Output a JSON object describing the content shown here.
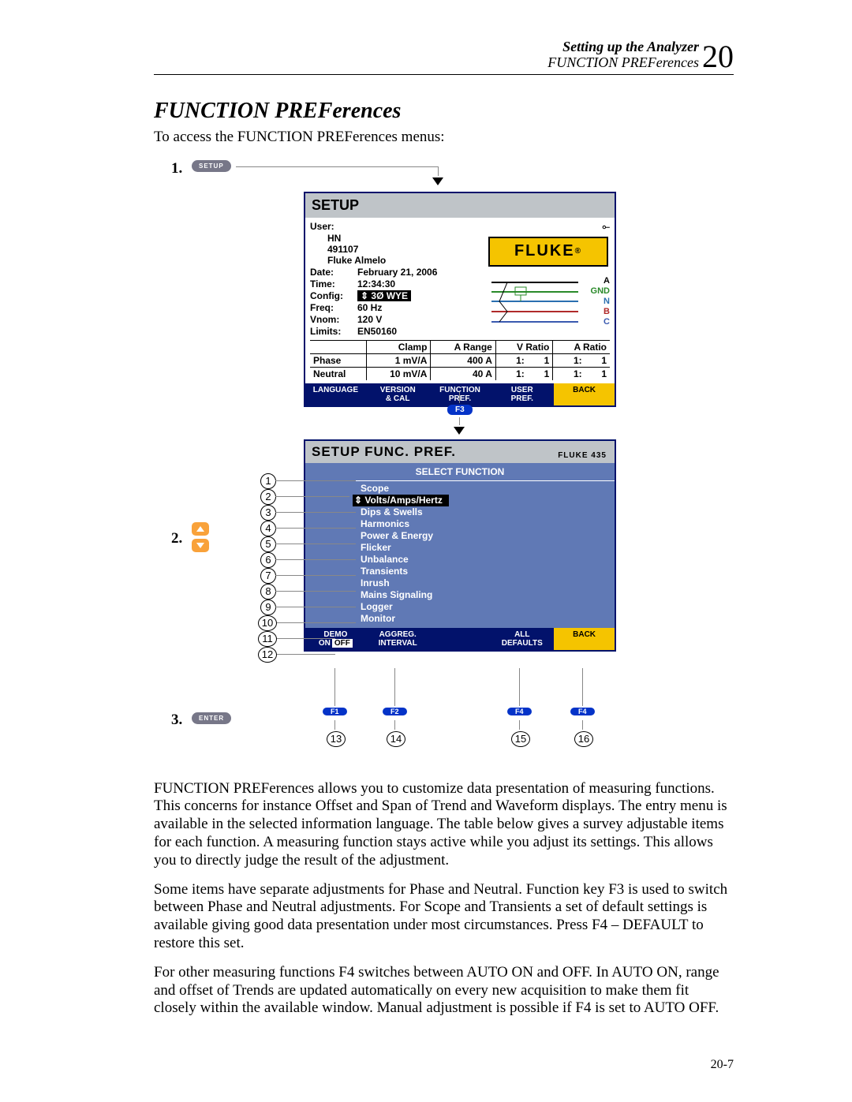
{
  "header": {
    "line1": "Setting up the Analyzer",
    "line2": "FUNCTION PREFerences",
    "chapter": "20"
  },
  "title": "FUNCTION PREFerences",
  "intro": "To access the FUNCTION PREFerences menus:",
  "steps": {
    "s1": "1.",
    "s2": "2.",
    "s3": "3."
  },
  "btn": {
    "setup": "SETUP",
    "enter": "ENTER"
  },
  "setup_screen": {
    "title": "SETUP",
    "user_label": "User:",
    "user_lines": [
      "HN",
      "491107",
      "Fluke Almelo"
    ],
    "date_k": "Date:",
    "date_v": "February 21, 2006",
    "time_k": "Time:",
    "time_v": "12:34:30",
    "config_k": "Config:",
    "config_v": "⇕ 3Ø WYE",
    "freq_k": "Freq:",
    "freq_v": "60 Hz",
    "vnom_k": "Vnom:",
    "vnom_v": "120 V",
    "limits_k": "Limits:",
    "limits_v": "EN50160",
    "logo": "FLUKE",
    "phase_labels": [
      "A",
      "GND",
      "N",
      "B",
      "C"
    ],
    "phase_colors": [
      "#000",
      "#2a8a2a",
      "#2a6fb0",
      "#b02a2a",
      "#3a5ab0"
    ],
    "table": {
      "head": [
        "",
        "Clamp",
        "A Range",
        "V Ratio",
        "A Ratio"
      ],
      "rows": [
        [
          "Phase",
          "1 mV/A",
          "400 A",
          "1:",
          "1",
          "1:",
          "1"
        ],
        [
          "Neutral",
          "10 mV/A",
          "40 A",
          "1:",
          "1",
          "1:",
          "1"
        ]
      ]
    },
    "softkeys": [
      "LANGUAGE",
      "VERSION\n& CAL",
      "FUNCTION\nPREF.",
      "USER\nPREF.",
      "BACK"
    ]
  },
  "f3": "F3",
  "func_screen": {
    "title": "SETUP FUNC. PREF.",
    "model": "FLUKE 435",
    "select": "SELECT FUNCTION",
    "items": [
      "Scope",
      "⇕ Volts/Amps/Hertz",
      "Dips & Swells",
      "Harmonics",
      "Power & Energy",
      "Flicker",
      "Unbalance",
      "Transients",
      "Inrush",
      "Mains Signaling",
      "Logger",
      "Monitor"
    ],
    "softkeys": {
      "f1a": "DEMO",
      "f1b": "ON",
      "f1c": "OFF",
      "f2": "AGGREG.\nINTERVAL",
      "f4": "ALL\nDEFAULTS",
      "f5": "BACK"
    }
  },
  "fkeys": [
    "F1",
    "F2",
    "F4",
    "F4"
  ],
  "circles": [
    "1",
    "2",
    "3",
    "4",
    "5",
    "6",
    "7",
    "8",
    "9",
    "10",
    "11",
    "12",
    "13",
    "14",
    "15",
    "16"
  ],
  "para1": "FUNCTION PREFerences allows you to customize data presentation of measuring functions. This concerns for instance Offset and Span of Trend and Waveform displays. The entry menu is available in the selected information language. The table below gives a survey adjustable items for each function. A measuring function stays active while you adjust its settings. This allows you to directly judge the result of the adjustment.",
  "para2": "Some items have separate adjustments for Phase and Neutral. Function key F3 is used to switch between Phase and Neutral adjustments. For Scope and Transients a set of default settings is available giving good data presentation under most circumstances. Press F4 – DEFAULT to restore this set.",
  "para3": "For other measuring functions F4 switches between AUTO ON and OFF. In AUTO ON, range and offset of Trends are updated automatically on every new acquisition to make them fit closely within the available window. Manual adjustment is possible if F4 is set to AUTO OFF.",
  "footer": "20-7"
}
